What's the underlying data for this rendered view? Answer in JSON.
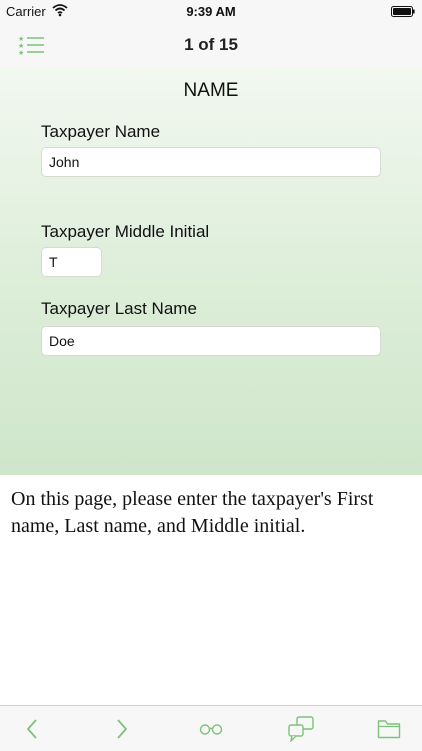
{
  "status_bar": {
    "carrier": "Carrier",
    "time": "9:39 AM"
  },
  "nav": {
    "title": "1 of 15",
    "left_icon": "starred-list-icon"
  },
  "form": {
    "section_title": "NAME",
    "fields": [
      {
        "label": "Taxpayer Name",
        "value": "John"
      },
      {
        "label": "Taxpayer Middle Initial",
        "value": "T"
      },
      {
        "label": "Taxpayer Last Name",
        "value": "Doe"
      }
    ]
  },
  "help_text": "On this page, please enter the taxpayer's First name, Last name, and Middle initial.",
  "toolbar": {
    "icons": [
      "back-arrow-icon",
      "forward-arrow-icon",
      "glasses-icon",
      "chat-bubbles-icon",
      "folder-icon"
    ]
  },
  "colors": {
    "accent": "#7dc27a",
    "panel_top": "#f2f8f0",
    "panel_bottom": "#cfe6cb"
  }
}
